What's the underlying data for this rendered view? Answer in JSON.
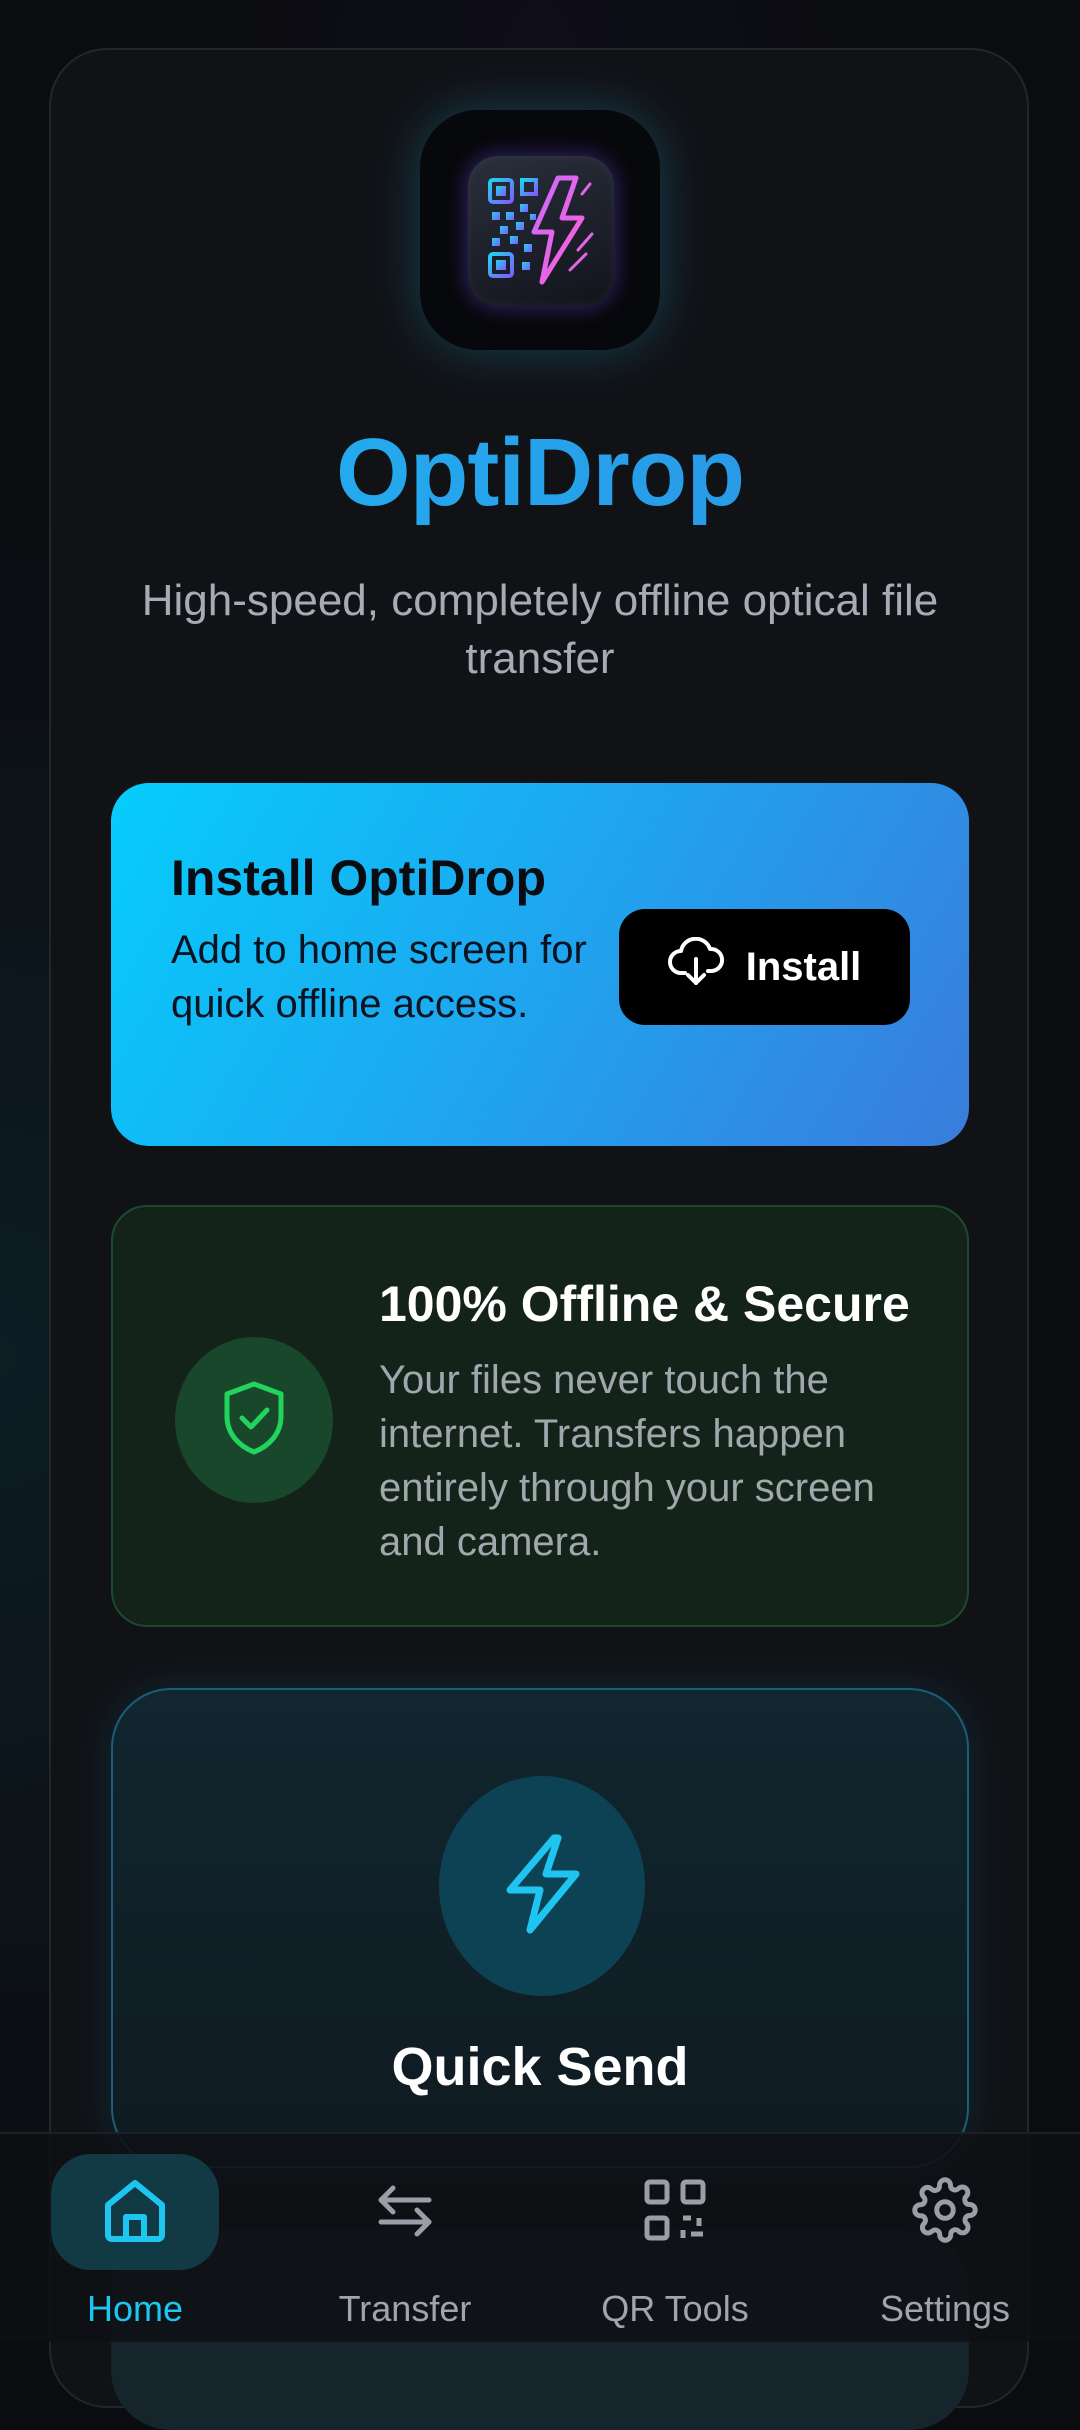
{
  "app": {
    "title": "OptiDrop",
    "subtitle": "High-speed, completely offline optical file transfer",
    "logo_icon": "qr-bolt-logo-icon"
  },
  "install_banner": {
    "title": "Install OptiDrop",
    "description": "Add to home screen for quick offline access.",
    "button_label": "Install",
    "button_icon": "cloud-download-icon"
  },
  "offline_card": {
    "title": "100% Offline & Secure",
    "description": "Your files never touch the internet. Transfers happen entirely through your screen and camera.",
    "icon": "shield-check-icon"
  },
  "quick_send": {
    "title": "Quick Send",
    "icon": "bolt-icon"
  },
  "bottom_nav": {
    "items": [
      {
        "label": "Home",
        "icon": "home-icon",
        "active": true
      },
      {
        "label": "Transfer",
        "icon": "transfer-arrows-icon",
        "active": false
      },
      {
        "label": "QR Tools",
        "icon": "qr-code-icon",
        "active": false
      },
      {
        "label": "Settings",
        "icon": "gear-icon",
        "active": false
      }
    ]
  },
  "colors": {
    "accent": "#1ec5f0",
    "brand_gradient_start": "#06cdfb",
    "brand_gradient_end": "#3a7cdb",
    "secure_green": "#22d35c",
    "background": "#0b0c10"
  }
}
